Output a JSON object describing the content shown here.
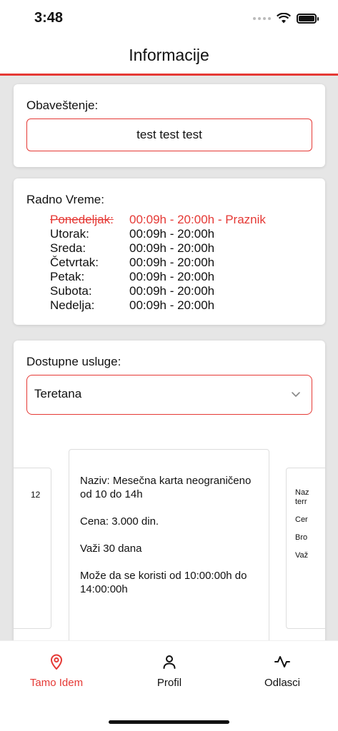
{
  "status_bar": {
    "time": "3:48"
  },
  "nav": {
    "title": "Informacije"
  },
  "notice": {
    "label": "Obaveštenje:",
    "text": "test test test"
  },
  "hours": {
    "label": "Radno Vreme:",
    "rows": [
      {
        "day": "Ponedeljak:",
        "time": "00:09h - 20:00h - Praznik",
        "holiday": true
      },
      {
        "day": "Utorak:",
        "time": "00:09h - 20:00h"
      },
      {
        "day": "Sreda:",
        "time": "00:09h - 20:00h"
      },
      {
        "day": "Četvrtak:",
        "time": "00:09h - 20:00h"
      },
      {
        "day": "Petak:",
        "time": "00:09h - 20:00h"
      },
      {
        "day": "Subota:",
        "time": "00:09h - 20:00h"
      },
      {
        "day": "Nedelja:",
        "time": "00:09h - 20:00h"
      }
    ]
  },
  "services": {
    "label": "Dostupne usluge:",
    "selected": "Teretana",
    "cards": {
      "left": {
        "text": "12"
      },
      "center": {
        "name": "Naziv: Mesečna karta neograničeno od 10 do 14h",
        "price": "Cena: 3.000 din.",
        "validity": "Važi 30 dana",
        "usage": "Može da se koristi od 10:00:00h do 14:00:00h"
      },
      "right": {
        "name": "Naz\nterr",
        "price": "Cer",
        "count": "Bro",
        "validity": "Važ"
      }
    }
  },
  "tabs": [
    {
      "label": "Tamo Idem",
      "icon": "location-pin-icon",
      "active": true
    },
    {
      "label": "Profil",
      "icon": "person-icon",
      "active": false
    },
    {
      "label": "Odlasci",
      "icon": "activity-icon",
      "active": false
    }
  ],
  "colors": {
    "accent": "#e53935"
  }
}
